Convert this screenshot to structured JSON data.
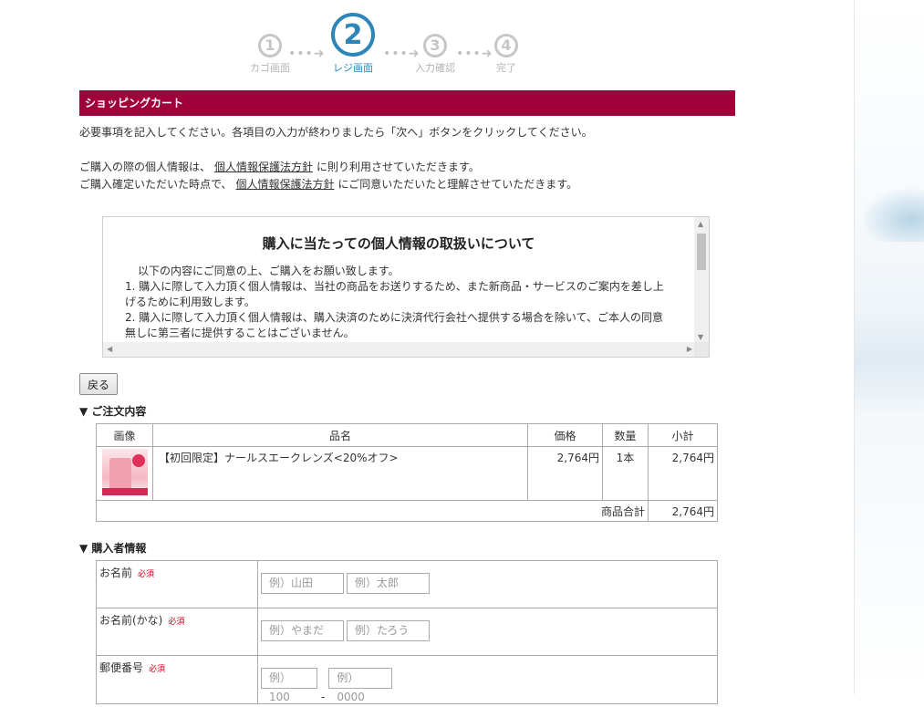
{
  "steps": [
    {
      "num": "1",
      "label": "カゴ画面"
    },
    {
      "num": "2",
      "label": "レジ画面"
    },
    {
      "num": "3",
      "label": "入力確認"
    },
    {
      "num": "4",
      "label": "完了"
    }
  ],
  "step_arrow": "•••➜",
  "cart_header": "ショッピングカート",
  "intro": {
    "line1": "必要事項を記入してください。各項目の入力が終わりましたら「次へ」ボタンをクリックしてください。",
    "line2_pre": "ご購入の際の個人情報は、",
    "line2_link": "個人情報保護法方針",
    "line2_post": "に則り利用させていただきます。",
    "line3_pre": "ご購入確定いただいた時点で、",
    "line3_link": "個人情報保護法方針",
    "line3_post": "にご同意いただいたと理解させていただきます。"
  },
  "privacy": {
    "title": "購入に当たっての個人情報の取扱いについて",
    "intro": "以下の内容にご同意の上、ご購入をお願い致します。",
    "item1": "1. 購入に際して入力頂く個人情報は、当社の商品をお送りするため、また新商品・サービスのご案内を差し上げるために利用致します。",
    "item2": "2. 購入に際して入力頂く個人情報は、購入決済のために決済代行会社へ提供する場合を除いて、ご本人の同意無しに第三者に提供することはございません。"
  },
  "back_button": "戻る",
  "order_section_title": "▼ ご注文内容",
  "order_table": {
    "headers": [
      "画像",
      "品名",
      "価格",
      "数量",
      "小計"
    ],
    "rows": [
      {
        "name": "【初回限定】ナールスエークレンズ<20%オフ>",
        "price": "2,764円",
        "qty": "1本",
        "subtotal": "2,764円"
      }
    ],
    "total_label": "商品合計",
    "total_value": "2,764円"
  },
  "buyer_section_title": "▼ 購入者情報",
  "buyer_fields": {
    "required": "必須",
    "name_label": "お名前",
    "name_last_placeholder": "例）山田",
    "name_first_placeholder": "例）太郎",
    "kana_label": "お名前(かな)",
    "kana_last_placeholder": "例）やまだ",
    "kana_first_placeholder": "例）たろう",
    "zip_label": "郵便番号",
    "zip1_placeholder": "例）100",
    "zip_separator": "-",
    "zip2_placeholder": "例）0000"
  }
}
